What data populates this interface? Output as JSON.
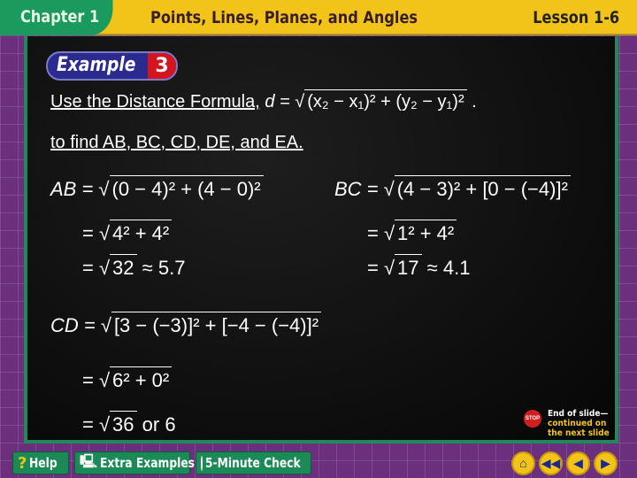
{
  "header": {
    "chapter": "Chapter 1",
    "title": "Points, Lines, Planes, and Angles",
    "lesson": "Lesson 1-6"
  },
  "example": {
    "word": "Example",
    "number": "3"
  },
  "intro": {
    "line1": "Use the Distance Formula,",
    "formula_lhs": "d =",
    "formula_rad": "(x₂ − x₁)² + (y₂ − y₁)²",
    "formula_end": ".",
    "line2": "to find AB, BC, CD, DE, and EA."
  },
  "ab": {
    "label": "AB =",
    "rad1": "(0 − 4)² + (4 − 0)²",
    "eq": "=",
    "rad2": "4² + 4²",
    "rad3": "32",
    "approx": "≈ 5.7"
  },
  "bc": {
    "label": "BC =",
    "rad1": "(4 − 3)² + [0 − (−4)]²",
    "eq": "=",
    "rad2": "1² + 4²",
    "rad3": "17",
    "approx": "≈ 4.1"
  },
  "cd": {
    "label": "CD =",
    "rad1": "[3 − (−3)]² + [−4 − (−4)]²",
    "eq": "=",
    "rad2": "6² + 0²",
    "rad3": "36",
    "approx": "or 6"
  },
  "end_of_slide": {
    "line1": "End of slide—",
    "line2": "continued on",
    "line3": "the next slide",
    "stop": "STOP"
  },
  "toolbar": {
    "help": "Help",
    "extra": "Extra Examples",
    "check": "5-Minute Check"
  },
  "colors": {
    "header": "#f2c419",
    "chapter": "#1a9a5c",
    "board": "#0a0a0a",
    "background": "#6b2f7e"
  }
}
